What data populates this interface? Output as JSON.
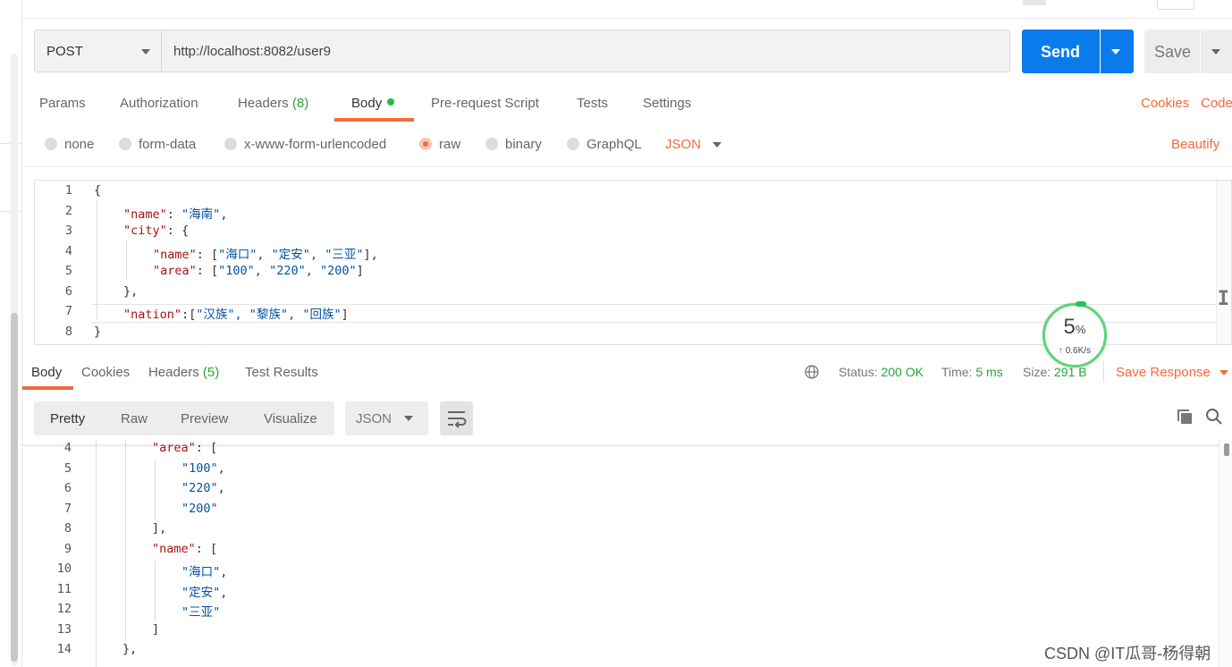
{
  "request": {
    "method": "POST",
    "url": "http://localhost:8082/user9",
    "send_label": "Send",
    "save_label": "Save"
  },
  "request_tabs": {
    "params": "Params",
    "authorization": "Authorization",
    "headers": "Headers",
    "headers_count": "(8)",
    "body": "Body",
    "prerequest": "Pre-request Script",
    "tests": "Tests",
    "settings": "Settings",
    "cookies": "Cookies",
    "code": "Code"
  },
  "body_types": {
    "none": "none",
    "form_data": "form-data",
    "urlencoded": "x-www-form-urlencoded",
    "raw": "raw",
    "binary": "binary",
    "graphql": "GraphQL",
    "format": "JSON",
    "beautify": "Beautify",
    "selected": "raw"
  },
  "request_body": [
    {
      "n": "1",
      "t": "{"
    },
    {
      "n": "2",
      "k": "\"name\"",
      "t": ": ",
      "s": "\"海南\"",
      "e": ","
    },
    {
      "n": "3",
      "k": "\"city\"",
      "t": ": {"
    },
    {
      "n": "4",
      "k": "\"name\"",
      "t": ": [",
      "s": "\"海口\", \"定安\", \"三亚\"",
      "e": "],"
    },
    {
      "n": "5",
      "k": "\"area\"",
      "t": ": [",
      "s": "\"100\", \"220\", \"200\"",
      "e": "]"
    },
    {
      "n": "6",
      "t": "},"
    },
    {
      "n": "7",
      "k": "\"nation\"",
      "t": ":[",
      "s": "\"汉族\", \"黎族\", \"回族\"",
      "e": "]"
    },
    {
      "n": "8",
      "t": "}"
    }
  ],
  "response_tabs": {
    "body": "Body",
    "cookies": "Cookies",
    "headers": "Headers",
    "headers_count": "(5)",
    "test_results": "Test Results"
  },
  "response_status": {
    "status_label": "Status:",
    "status_value": "200 OK",
    "time_label": "Time:",
    "time_value": "5 ms",
    "size_label": "Size:",
    "size_value": "291 B",
    "save_response": "Save Response"
  },
  "response_view": {
    "pretty": "Pretty",
    "raw": "Raw",
    "preview": "Preview",
    "visualize": "Visualize",
    "format": "JSON"
  },
  "response_body": [
    {
      "n": "4",
      "k": "\"area\"",
      "t": ": ["
    },
    {
      "n": "5",
      "s": "\"100\"",
      "t": ","
    },
    {
      "n": "6",
      "s": "\"220\"",
      "t": ","
    },
    {
      "n": "7",
      "s": "\"200\""
    },
    {
      "n": "8",
      "t": "],"
    },
    {
      "n": "9",
      "k": "\"name\"",
      "t": ": ["
    },
    {
      "n": "10",
      "s": "\"海口\"",
      "t": ","
    },
    {
      "n": "11",
      "s": "\"定安\"",
      "t": ","
    },
    {
      "n": "12",
      "s": "\"三亚\""
    },
    {
      "n": "13",
      "t": "]"
    },
    {
      "n": "14",
      "t": "},"
    }
  ],
  "speed_widget": {
    "percent": "5",
    "percent_sign": "%",
    "rate": "0.6K/s"
  },
  "watermark": "CSDN @IT瓜哥-杨得朝",
  "colors": {
    "accent": "#f26b3a",
    "send": "#097bed",
    "success": "#26a53a"
  }
}
